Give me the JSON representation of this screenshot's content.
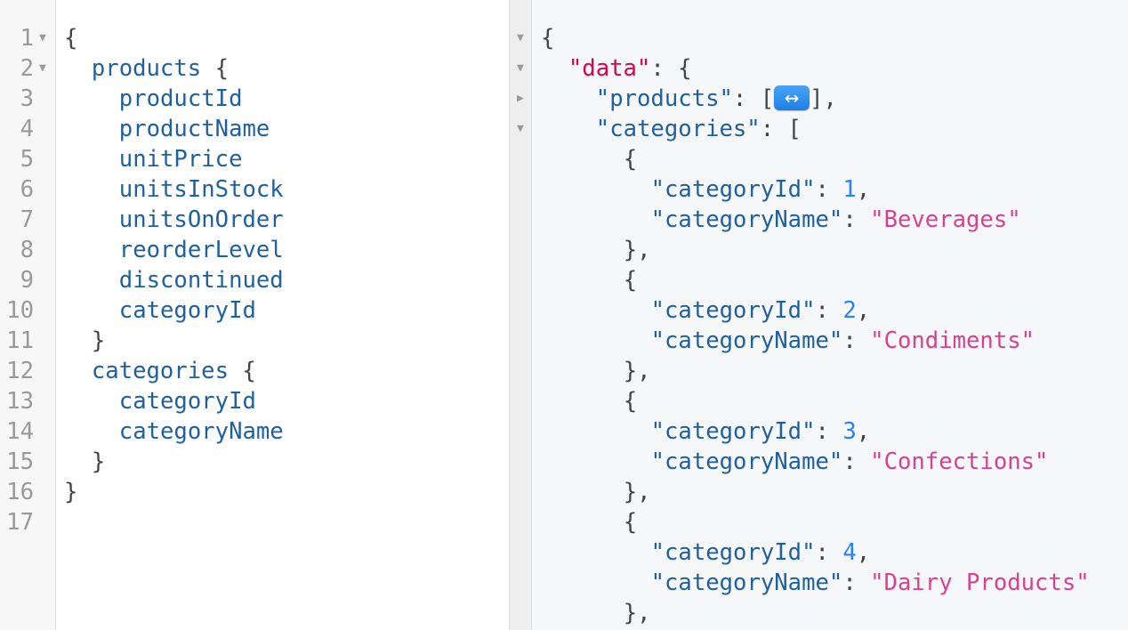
{
  "query_editor": {
    "line_numbers": [
      "1",
      "2",
      "3",
      "4",
      "5",
      "6",
      "7",
      "8",
      "9",
      "10",
      "11",
      "12",
      "13",
      "14",
      "15",
      "16",
      "17"
    ],
    "lines": [
      {
        "indent": 0,
        "text": "{",
        "kind": "punc",
        "fold": "expanded"
      },
      {
        "indent": 1,
        "text": "products",
        "suffix": " {",
        "kind": "field",
        "fold": "expanded"
      },
      {
        "indent": 2,
        "text": "productId",
        "kind": "field"
      },
      {
        "indent": 2,
        "text": "productName",
        "kind": "field"
      },
      {
        "indent": 2,
        "text": "unitPrice",
        "kind": "field"
      },
      {
        "indent": 2,
        "text": "unitsInStock",
        "kind": "field"
      },
      {
        "indent": 2,
        "text": "unitsOnOrder",
        "kind": "field"
      },
      {
        "indent": 2,
        "text": "reorderLevel",
        "kind": "field"
      },
      {
        "indent": 2,
        "text": "discontinued",
        "kind": "field"
      },
      {
        "indent": 2,
        "text": "categoryId",
        "kind": "field"
      },
      {
        "indent": 1,
        "text": "}",
        "kind": "punc"
      },
      {
        "indent": 1,
        "text": "categories",
        "suffix": " {",
        "kind": "field"
      },
      {
        "indent": 2,
        "text": "categoryId",
        "kind": "field"
      },
      {
        "indent": 2,
        "text": "categoryName",
        "kind": "field"
      },
      {
        "indent": 1,
        "text": "}",
        "kind": "punc"
      },
      {
        "indent": 0,
        "text": "}",
        "kind": "punc"
      },
      {
        "indent": 0,
        "text": "",
        "kind": "punc"
      }
    ]
  },
  "result_viewer": {
    "fold_markers": [
      "expanded",
      "expanded",
      "collapsed",
      "expanded"
    ],
    "root_open": "{",
    "data_key": "\"data\"",
    "data_open": ": {",
    "products_key": "\"products\"",
    "products_open": ": [",
    "products_close": "],",
    "collapse_icon": "↔",
    "categories_key": "\"categories\"",
    "categories_open": ": [",
    "categories": [
      {
        "id_key": "\"categoryId\"",
        "id": "1",
        "name_key": "\"categoryName\"",
        "name": "\"Beverages\""
      },
      {
        "id_key": "\"categoryId\"",
        "id": "2",
        "name_key": "\"categoryName\"",
        "name": "\"Condiments\""
      },
      {
        "id_key": "\"categoryId\"",
        "id": "3",
        "name_key": "\"categoryName\"",
        "name": "\"Confections\""
      },
      {
        "id_key": "\"categoryId\"",
        "id": "4",
        "name_key": "\"categoryName\"",
        "name": "\"Dairy Products\""
      }
    ],
    "obj_open": "{",
    "obj_close": "},",
    "colon": ": ",
    "comma": ","
  },
  "colors": {
    "field": "#1f61a0",
    "data_key": "#d2054e",
    "number": "#2882f9",
    "string": "#d64292",
    "punctuation": "#444444"
  }
}
